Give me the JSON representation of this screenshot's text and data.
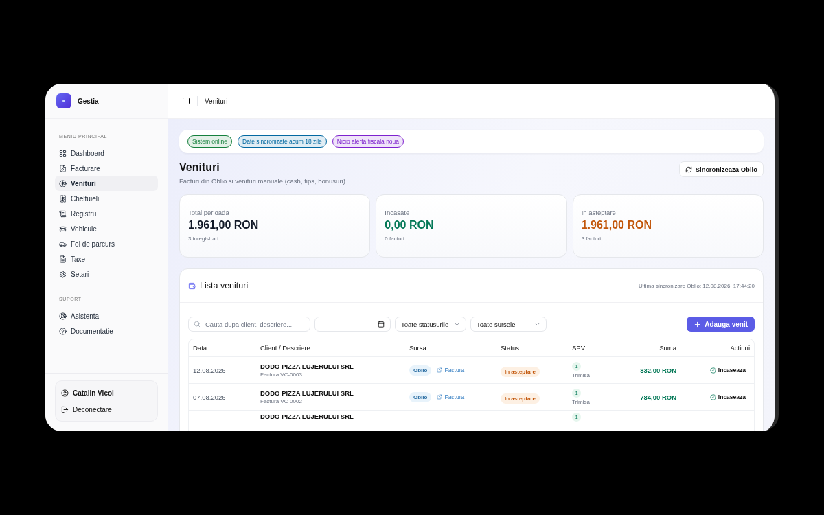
{
  "app": {
    "name": "Gestia"
  },
  "sidebar": {
    "sections": [
      {
        "title": "MENIU PRINCIPAL",
        "items": [
          {
            "label": "Dashboard",
            "selected": false
          },
          {
            "label": "Facturare",
            "selected": false
          },
          {
            "label": "Venituri",
            "selected": true
          },
          {
            "label": "Cheltuieli",
            "selected": false
          },
          {
            "label": "Registru",
            "selected": false
          },
          {
            "label": "Vehicule",
            "selected": false
          },
          {
            "label": "Foi de parcurs",
            "selected": false
          },
          {
            "label": "Taxe",
            "selected": false
          },
          {
            "label": "Setari",
            "selected": false
          }
        ]
      },
      {
        "title": "SUPORT",
        "items": [
          {
            "label": "Asistenta",
            "selected": false
          },
          {
            "label": "Documentatie",
            "selected": false
          }
        ]
      }
    ],
    "user": {
      "name": "Catalin Vicol",
      "logout": "Deconectare"
    }
  },
  "header": {
    "breadcrumb": "Venituri"
  },
  "status_pills": [
    {
      "label": "Sistem online",
      "color": "#15803d"
    },
    {
      "label": "Date sincronizate acum 18 zile",
      "color": "#0369a1"
    },
    {
      "label": "Nicio alerta fiscala noua",
      "color": "#7e22ce"
    }
  ],
  "page": {
    "title": "Venituri",
    "subtitle": "Facturi din Oblio si venituri manuale (cash, tips, bonusuri).",
    "sync_button": "Sincronizeaza Oblio"
  },
  "stats": [
    {
      "label": "Total perioada",
      "value": "1.961,00 RON",
      "note": "3 inregistrari",
      "color": "#111827"
    },
    {
      "label": "Incasate",
      "value": "0,00 RON",
      "note": "0 facturi",
      "color": "#047857"
    },
    {
      "label": "In asteptare",
      "value": "1.961,00 RON",
      "note": "3 facturi",
      "color": "#c2570c"
    }
  ],
  "list": {
    "title": "Lista venituri",
    "last_sync": "Ultima sincronizare Oblio: 12.08.2026, 17:44:20",
    "search": {
      "placeholder": "Cauta dupa client, descriere..."
    },
    "date_field": {
      "value": "---------- ----"
    },
    "filters": [
      "Toate statusurile",
      "Toate sursele"
    ],
    "add_button": "Adauga venit",
    "columns": [
      "Data",
      "Client / Descriere",
      "Sursa",
      "Status",
      "SPV",
      "Suma",
      "Actiuni"
    ],
    "rows": [
      {
        "date": "12.08.2026",
        "client": "DODO PIZZA LUJERULUI SRL",
        "description": "Factura VC-0003",
        "source": "Oblio",
        "link": "Factura",
        "status": "In asteptare",
        "spv_count": "1",
        "spv_status": "Trimisa",
        "amount": "832,00 RON",
        "action": "Incaseaza"
      },
      {
        "date": "07.08.2026",
        "client": "DODO PIZZA LUJERULUI SRL",
        "description": "Factura VC-0002",
        "source": "Oblio",
        "link": "Factura",
        "status": "In asteptare",
        "spv_count": "1",
        "spv_status": "Trimisa",
        "amount": "784,00 RON",
        "action": "Incaseaza"
      },
      {
        "client": "DODO PIZZA LUJERULUI SRL",
        "spv_count": "1"
      }
    ]
  }
}
